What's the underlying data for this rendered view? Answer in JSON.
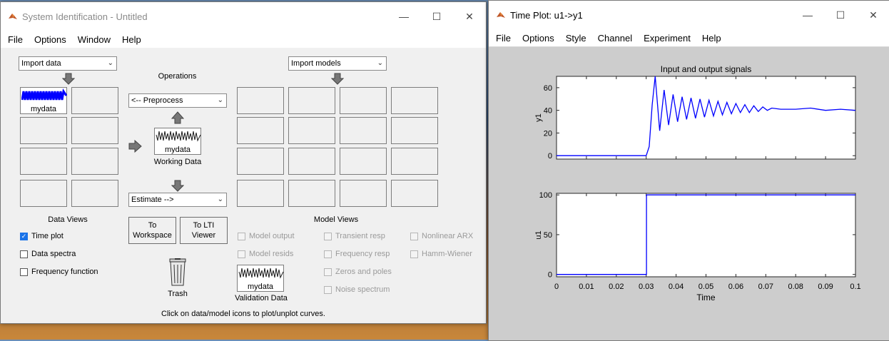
{
  "sysid": {
    "title": "System Identification - Untitled",
    "menu": [
      "File",
      "Options",
      "Window",
      "Help"
    ],
    "import_data": "Import data",
    "import_models": "Import models",
    "operations_label": "Operations",
    "preprocess": "<-- Preprocess",
    "estimate": "Estimate -->",
    "data_icon_label": "mydata",
    "working_data_icon_label": "mydata",
    "working_data_caption": "Working Data",
    "validation_icon_label": "mydata",
    "validation_caption": "Validation Data",
    "trash_label": "Trash",
    "to_workspace": "To Workspace",
    "to_lti_viewer": "To LTI Viewer",
    "data_views_title": "Data Views",
    "data_views": [
      {
        "label": "Time plot",
        "checked": true
      },
      {
        "label": "Data spectra",
        "checked": false
      },
      {
        "label": "Frequency function",
        "checked": false
      }
    ],
    "model_views_title": "Model Views",
    "model_views_col1": [
      "Model output",
      "Model resids"
    ],
    "model_views_col2": [
      "Transient resp",
      "Frequency resp",
      "Zeros and poles",
      "Noise spectrum"
    ],
    "model_views_col3": [
      "Nonlinear ARX",
      "Hamm-Wiener"
    ],
    "status": "Click on data/model icons to plot/unplot curves.",
    "data_color": "#0000ff"
  },
  "timeplot": {
    "title": "Time Plot: u1->y1",
    "menu": [
      "File",
      "Options",
      "Style",
      "Channel",
      "Experiment",
      "Help"
    ],
    "chart_data": {
      "type": "line",
      "title": "Input and output signals",
      "xlabel": "Time",
      "xlim": [
        0,
        0.1
      ],
      "xticks": [
        "0",
        "0.01",
        "0.02",
        "0.03",
        "0.04",
        "0.05",
        "0.06",
        "0.07",
        "0.08",
        "0.09",
        "0.1"
      ],
      "color": "#0000ff",
      "panels": [
        {
          "ylabel": "y1",
          "ylim": [
            -3,
            70
          ],
          "yticks": [
            "0",
            "20",
            "40",
            "60"
          ],
          "series": [
            {
              "x": [
                0,
                0.01,
                0.02,
                0.03,
                0.031,
                0.032,
                0.033,
                0.0345,
                0.036,
                0.0375,
                0.039,
                0.0405,
                0.042,
                0.0435,
                0.045,
                0.0465,
                0.048,
                0.0495,
                0.051,
                0.0525,
                0.054,
                0.0555,
                0.057,
                0.0585,
                0.06,
                0.0615,
                0.063,
                0.0645,
                0.066,
                0.0675,
                0.069,
                0.0705,
                0.072,
                0.075,
                0.08,
                0.085,
                0.09,
                0.095,
                0.1
              ],
              "y": [
                0,
                0,
                0,
                0,
                8,
                45,
                70,
                22,
                58,
                27,
                54,
                30,
                52,
                32,
                51,
                33,
                50,
                34,
                49,
                35,
                48,
                36,
                47,
                37,
                46,
                38,
                45,
                38,
                44,
                39,
                43,
                40,
                42,
                41,
                41,
                42,
                40,
                41,
                40
              ]
            }
          ]
        },
        {
          "ylabel": "u1",
          "ylim": [
            -3,
            102
          ],
          "yticks": [
            "0",
            "50",
            "100"
          ],
          "series": [
            {
              "x": [
                0,
                0.0301,
                0.0301,
                0.1
              ],
              "y": [
                0,
                0,
                100,
                100
              ]
            }
          ]
        }
      ]
    }
  }
}
